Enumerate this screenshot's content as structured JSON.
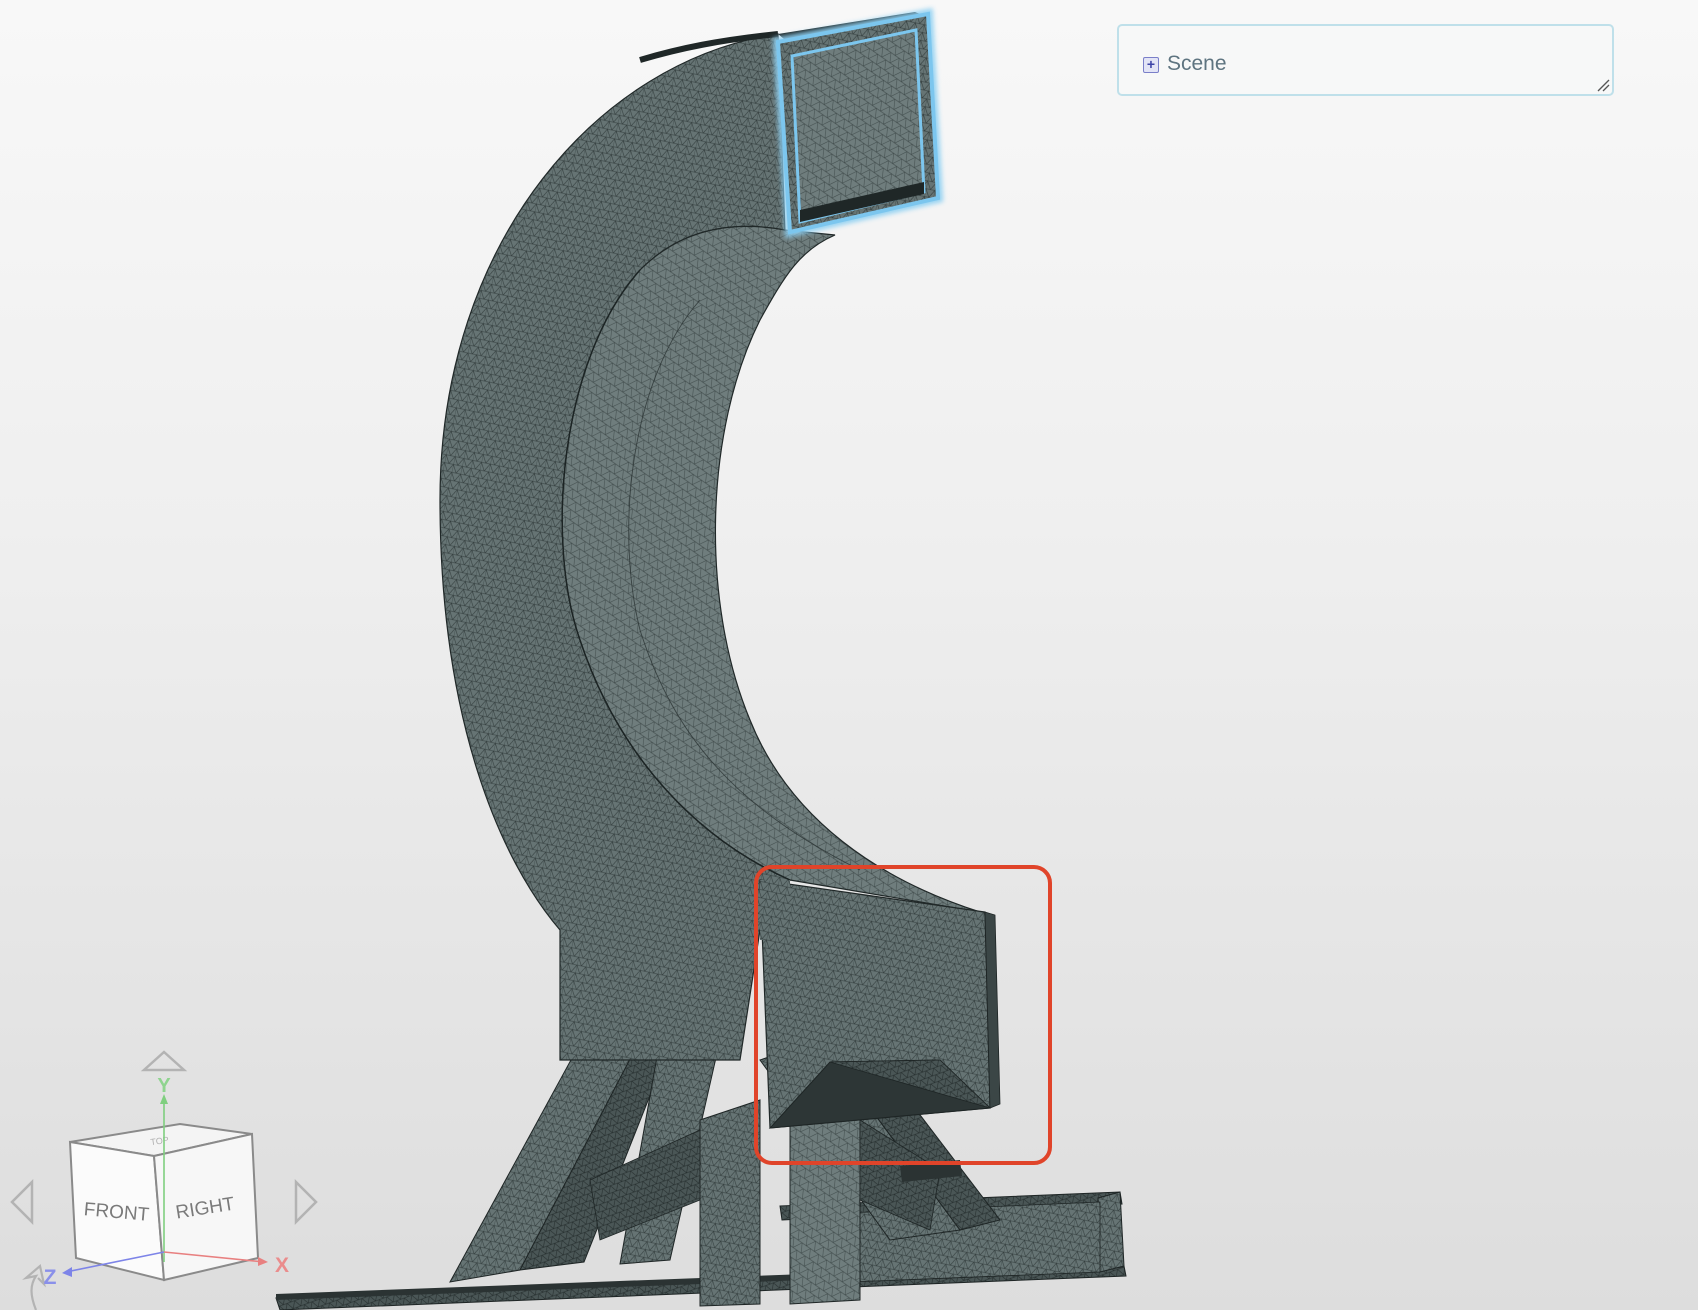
{
  "scene_panel": {
    "label": "Scene",
    "expand_icon": "plus-square-icon",
    "resize_icon": "resize-grip-icon"
  },
  "view_cube": {
    "faces": {
      "front": "FRONT",
      "right": "RIGHT",
      "top": "TOP"
    },
    "axes": {
      "x": "X",
      "y": "Y",
      "z": "Z"
    },
    "nav_icons": [
      "arrow-up-icon",
      "arrow-left-icon",
      "arrow-right-icon",
      "rotate-icon"
    ]
  },
  "colors": {
    "mesh": "#5f6d6d",
    "selection_highlight": "#8fd0f2",
    "annotation_box": "#e0442a",
    "axis_x": "#e88080",
    "axis_y": "#7fcf7f",
    "axis_z": "#7d84e8"
  }
}
